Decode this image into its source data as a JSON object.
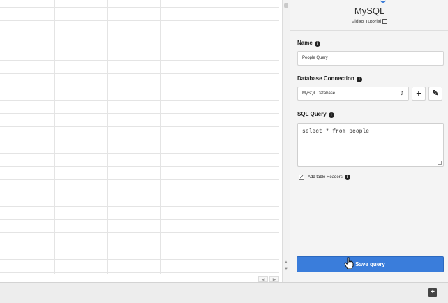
{
  "panel": {
    "title": "MySQL",
    "tutorial_label": "Video Tutorial",
    "name_label": "Name",
    "name_value": "People Query",
    "connection_label": "Database Connection",
    "connection_value": "MySQL Database",
    "query_label": "SQL Query",
    "query_value": "select * from people",
    "headers_label": "Add table Headers",
    "headers_checked": true,
    "save_label": "Save query",
    "accent": "#3a7ddb"
  },
  "icons": {
    "info": "info-icon",
    "add": "plus-icon",
    "edit": "edit-icon",
    "external": "external-link-icon",
    "bottom": "plus-square-icon"
  }
}
